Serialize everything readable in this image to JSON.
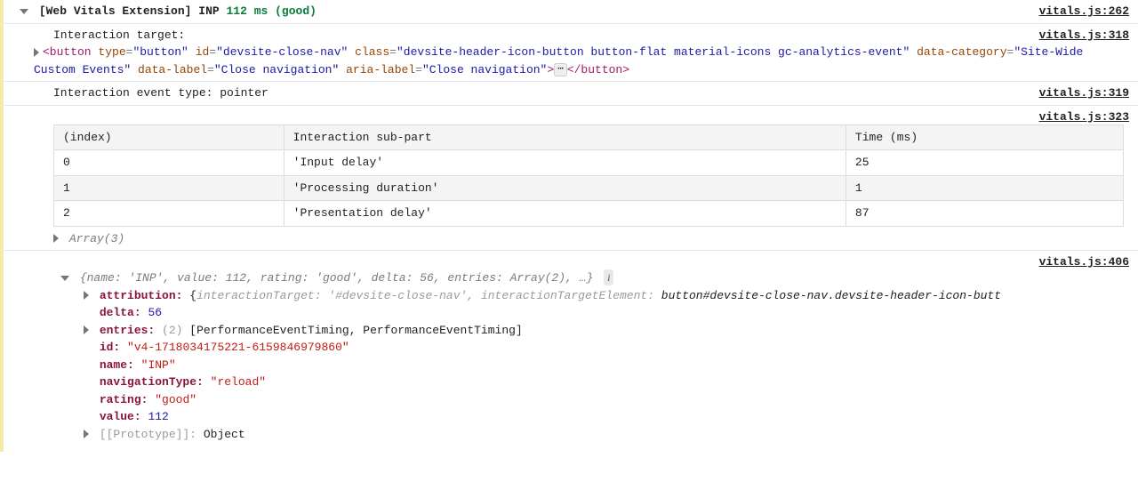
{
  "rows": {
    "r1": {
      "arrow": "▼",
      "prefix": "[Web Vitals Extension]",
      "metric": "INP",
      "value": "112 ms",
      "rating": "(good)",
      "src": "vitals.js:262"
    },
    "r2": {
      "label": "Interaction target:",
      "src": "vitals.js:318",
      "html_tag_open": "<button",
      "attrs": [
        {
          "n": "type",
          "v": "\"button\""
        },
        {
          "n": "id",
          "v": "\"devsite-close-nav\""
        },
        {
          "n": "class",
          "v": "\"devsite-header-icon-button button-flat material-icons gc-analytics-event\""
        },
        {
          "n": "data-category",
          "v": "\"Site-Wide Custom Events\""
        },
        {
          "n": "data-label",
          "v": "\"Close navigation\""
        },
        {
          "n": "aria-label",
          "v": "\"Close navigation\""
        }
      ],
      "html_tag_close_gt": ">",
      "ellipsis": "⋯",
      "html_end": "</button>"
    },
    "r3": {
      "text": "Interaction event type: pointer",
      "src": "vitals.js:319"
    },
    "r4": {
      "src": "vitals.js:323",
      "headers": [
        "(index)",
        "Interaction sub-part",
        "Time (ms)"
      ],
      "data": [
        [
          "0",
          "'Input delay'",
          "25"
        ],
        [
          "1",
          "'Processing duration'",
          "1"
        ],
        [
          "2",
          "'Presentation delay'",
          "87"
        ]
      ],
      "footer": "Array(3)"
    },
    "r5": {
      "src": "vitals.js:406",
      "summary_pre": "{",
      "summary_parts": [
        {
          "k": "name",
          "v": "'INP'"
        },
        {
          "k": "value",
          "v": "112"
        },
        {
          "k": "rating",
          "v": "'good'"
        },
        {
          "k": "delta",
          "v": "56"
        },
        {
          "k": "entries",
          "v": "Array(2)"
        }
      ],
      "summary_post": ", …}",
      "info": "i",
      "props": {
        "attribution_key": "attribution:",
        "attribution_open": "{",
        "attribution_p1k": "interactionTarget",
        "attribution_p1v": "'#devsite-close-nav'",
        "attribution_p2k": "interactionTargetElement",
        "attribution_p2v": "button#devsite-close-nav.devsite-header-icon-butt",
        "delta_k": "delta:",
        "delta_v": "56",
        "entries_k": "entries:",
        "entries_count": "(2)",
        "entries_v": "[PerformanceEventTiming, PerformanceEventTiming]",
        "id_k": "id:",
        "id_v": "\"v4-1718034175221-6159846979860\"",
        "name_k": "name:",
        "name_v": "\"INP\"",
        "nav_k": "navigationType:",
        "nav_v": "\"reload\"",
        "rating_k": "rating:",
        "rating_v": "\"good\"",
        "value_k": "value:",
        "value_v": "112",
        "proto_k": "[[Prototype]]:",
        "proto_v": "Object"
      }
    }
  }
}
